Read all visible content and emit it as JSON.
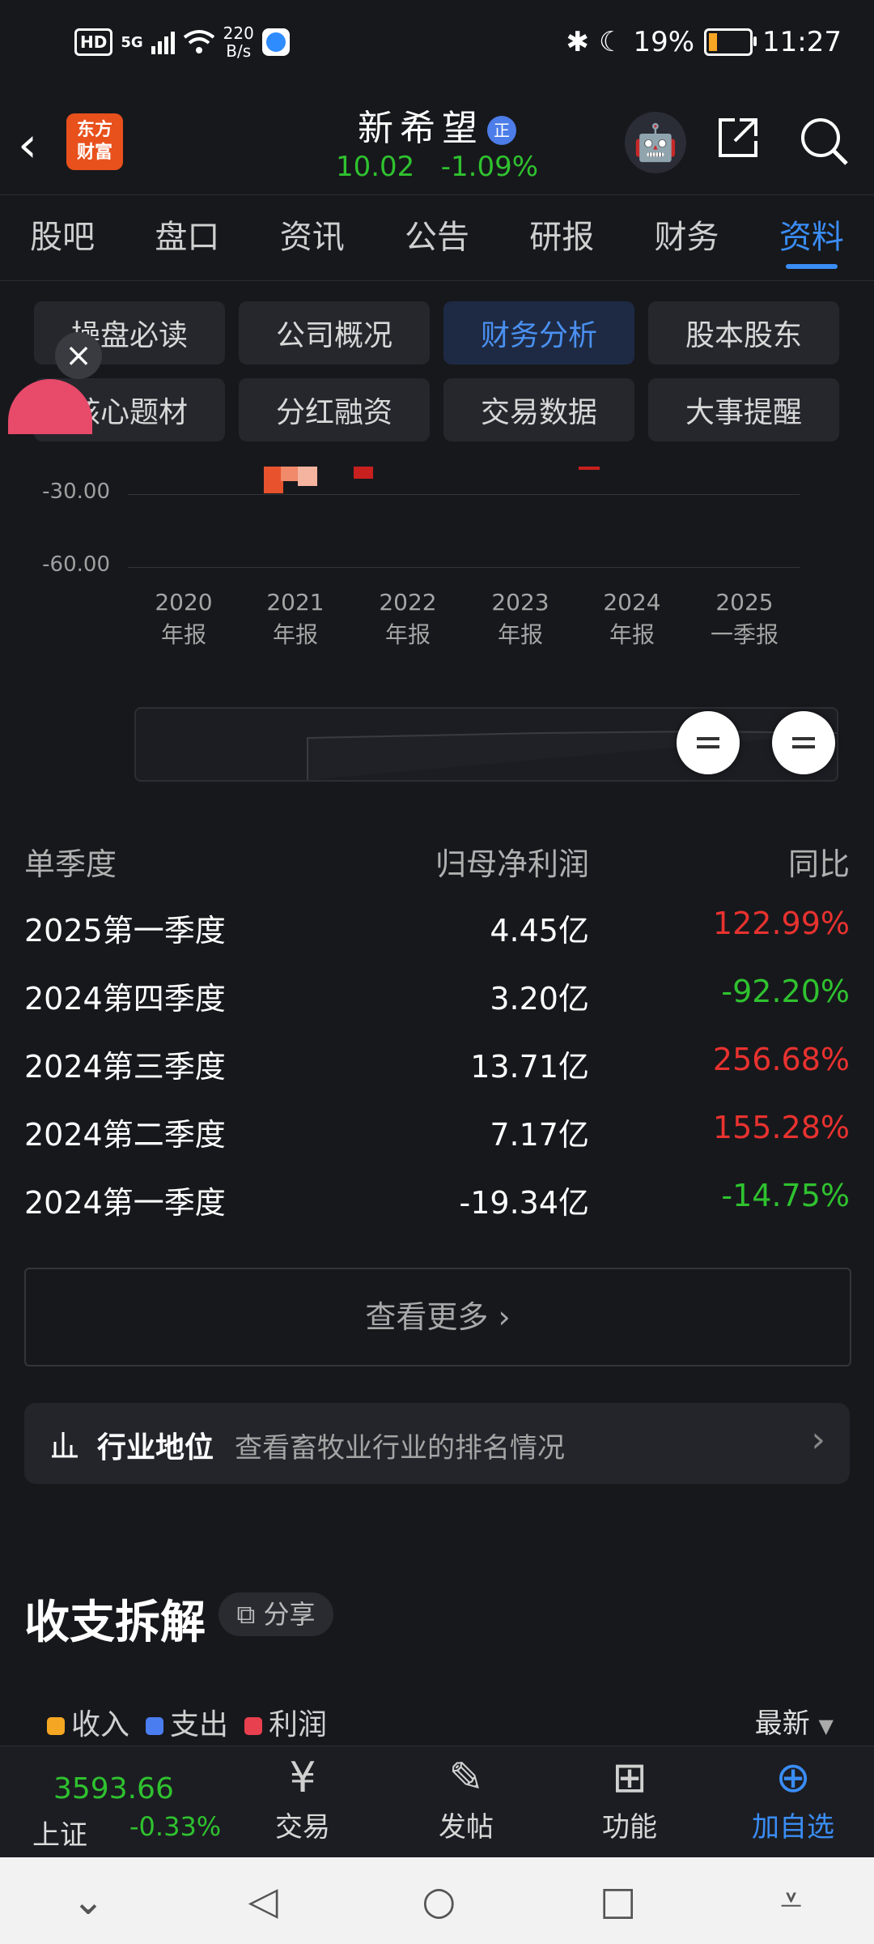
{
  "status_bar": {
    "hd": "HD",
    "network": "5G",
    "speed_value": "220",
    "speed_unit": "B/s",
    "battery": "19%",
    "time": "11:27"
  },
  "header": {
    "logo_line1": "东方",
    "logo_line2": "财富",
    "stock_name": "新希望",
    "badge": "正",
    "price": "10.02",
    "change": "-1.09%"
  },
  "tabs": [
    "股吧",
    "盘口",
    "资讯",
    "公告",
    "研报",
    "财务",
    "资料"
  ],
  "active_tab": "资料",
  "sub_nav": [
    "操盘必读",
    "公司概况",
    "财务分析",
    "股本股东",
    "核心题材",
    "分红融资",
    "交易数据",
    "大事提醒"
  ],
  "active_sub_nav": "财务分析",
  "chart_data": {
    "type": "bar",
    "y_ticks": [
      "-30.00",
      "-60.00"
    ],
    "x_ticks": [
      {
        "year": "2020",
        "period": "年报"
      },
      {
        "year": "2021",
        "period": "年报"
      },
      {
        "year": "2022",
        "period": "年报"
      },
      {
        "year": "2023",
        "period": "年报"
      },
      {
        "year": "2024",
        "period": "年报"
      },
      {
        "year": "2025",
        "period": "一季报"
      }
    ],
    "ylim": [
      -60,
      0
    ],
    "bars": [
      {
        "x": 0.8,
        "value": -17,
        "color": "#e8532e"
      },
      {
        "x": 0.95,
        "value": -12,
        "color": "#f08a6a"
      },
      {
        "x": 1.1,
        "value": -14,
        "color": "#f4b4a0"
      },
      {
        "x": 1.6,
        "value": -11,
        "color": "#c8201e"
      },
      {
        "x": 3.6,
        "value": -1,
        "color": "#c8201e"
      }
    ]
  },
  "table": {
    "headers": [
      "单季度",
      "归母净利润",
      "同比"
    ],
    "rows": [
      {
        "period": "2025第一季度",
        "profit": "4.45亿",
        "yoy": "122.99%",
        "dir": "up"
      },
      {
        "period": "2024第四季度",
        "profit": "3.20亿",
        "yoy": "-92.20%",
        "dir": "down"
      },
      {
        "period": "2024第三季度",
        "profit": "13.71亿",
        "yoy": "256.68%",
        "dir": "up"
      },
      {
        "period": "2024第二季度",
        "profit": "7.17亿",
        "yoy": "155.28%",
        "dir": "up"
      },
      {
        "period": "2024第一季度",
        "profit": "-19.34亿",
        "yoy": "-14.75%",
        "dir": "down"
      }
    ]
  },
  "more_label": "查看更多",
  "industry": {
    "title": "行业地位",
    "desc": "查看畜牧业行业的排名情况"
  },
  "section": {
    "title": "收支拆解",
    "share": "分享"
  },
  "legend": [
    {
      "label": "收入",
      "color": "#f5a623"
    },
    {
      "label": "支出",
      "color": "#4a7df0"
    },
    {
      "label": "利润",
      "color": "#e8404f"
    }
  ],
  "latest_label": "最新",
  "toolbar": {
    "index_value": "3593.66",
    "index_name": "上证",
    "index_change": "-0.33%",
    "items": [
      {
        "label": "交易",
        "icon": "yuan-icon"
      },
      {
        "label": "发帖",
        "icon": "edit-icon"
      },
      {
        "label": "功能",
        "icon": "grid-icon"
      },
      {
        "label": "加自选",
        "icon": "plus-circle-icon"
      }
    ]
  }
}
